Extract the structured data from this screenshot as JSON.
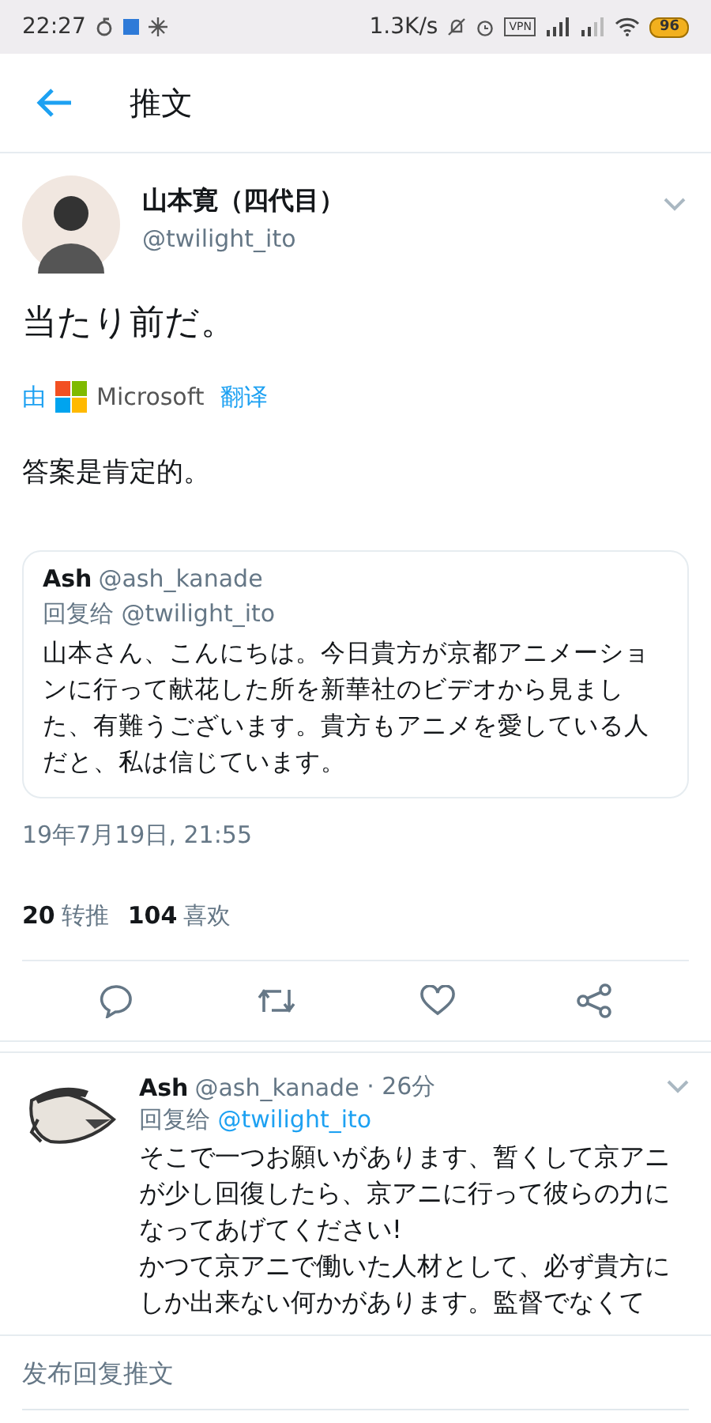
{
  "status_bar": {
    "time": "22:27",
    "net_speed": "1.3K/s",
    "vpn": "VPN",
    "battery": "96"
  },
  "header": {
    "title": "推文"
  },
  "tweet": {
    "name": "山本寛（四代目）",
    "handle": "@twilight_ito",
    "text": "当たり前だ。",
    "translate": {
      "by": "由",
      "brand": "Microsoft",
      "action": "翻译"
    },
    "translation": "答案是肯定的。",
    "quote": {
      "name": "Ash",
      "handle": "@ash_kanade",
      "reply_to_label": "回复给",
      "reply_to": "@twilight_ito",
      "text": "山本さん、こんにちは。今日貴方が京都アニメーションに行って献花した所を新華社のビデオから見ました、有難うございます。貴方もアニメを愛している人だと、私は信じています。"
    },
    "timestamp": "19年7月19日, 21:55",
    "stats": [
      {
        "count": "20",
        "label": "转推"
      },
      {
        "count": "104",
        "label": "喜欢"
      }
    ]
  },
  "replies": [
    {
      "name": "Ash",
      "handle": "@ash_kanade",
      "time": "· 26分",
      "reply_to_label": "回复给",
      "reply_to": "@twilight_ito",
      "text": "そこで一つお願いがあります、暂くして京アニが少し回復したら、京アニに行って彼らの力になってあげてください!\nかつて京アニで働いた人材として、必ず貴方にしか出来ない何かがあります。監督でなくて"
    }
  ],
  "compose": {
    "placeholder": "发布回复推文"
  }
}
